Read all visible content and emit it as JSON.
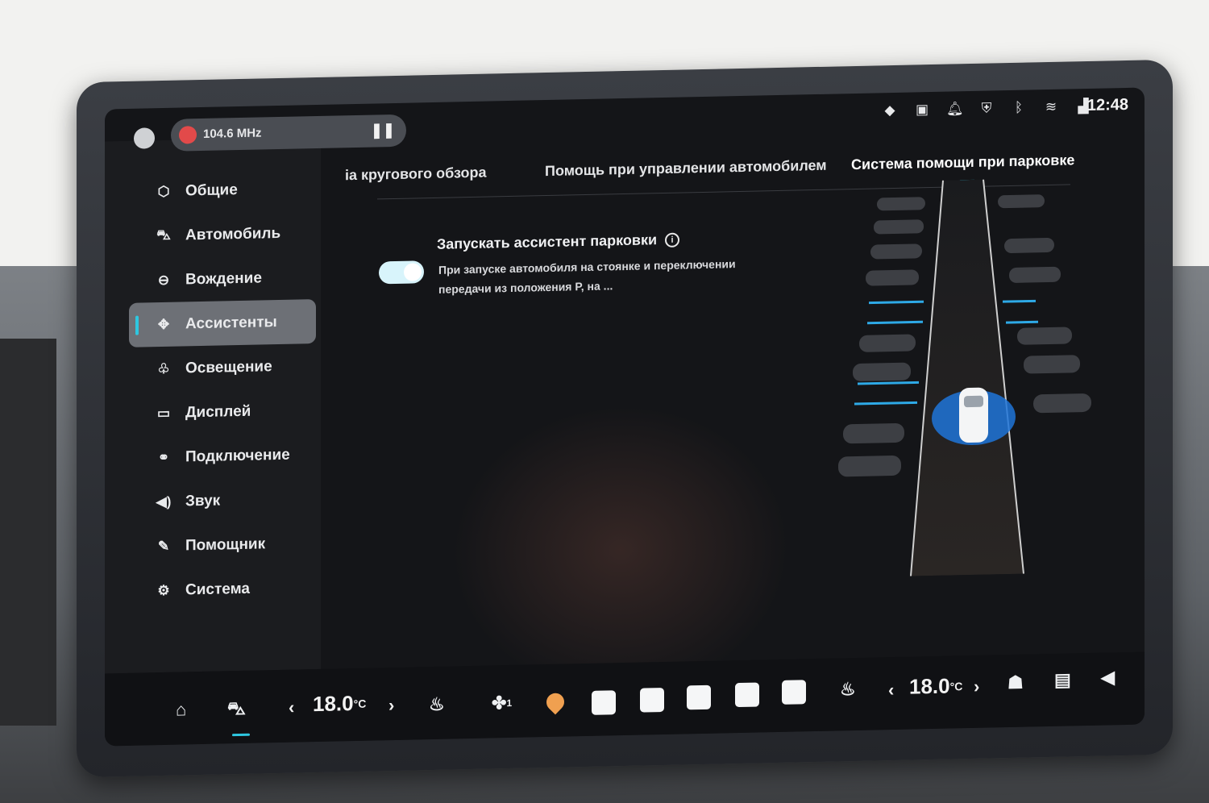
{
  "status_bar": {
    "media_text": "104.6 MHz",
    "pause_glyph": "❚❚",
    "icons": [
      "map-pin-icon",
      "phone-projection-icon",
      "bell-icon",
      "shield-icon",
      "bluetooth-icon",
      "wifi-icon",
      "signal-icon"
    ],
    "time": "12:48"
  },
  "sidebar": {
    "items": [
      {
        "label": "Общие",
        "icon": "general-icon",
        "active": false
      },
      {
        "label": "Автомобиль",
        "icon": "car-icon",
        "active": false
      },
      {
        "label": "Вождение",
        "icon": "steering-wheel-icon",
        "active": false
      },
      {
        "label": "Ассистенты",
        "icon": "assistant-icon",
        "active": true
      },
      {
        "label": "Освещение",
        "icon": "light-icon",
        "active": false
      },
      {
        "label": "Дисплей",
        "icon": "display-icon",
        "active": false
      },
      {
        "label": "Подключение",
        "icon": "link-icon",
        "active": false
      },
      {
        "label": "Звук",
        "icon": "speaker-icon",
        "active": false
      },
      {
        "label": "Помощник",
        "icon": "voice-assistant-icon",
        "active": false
      },
      {
        "label": "Система",
        "icon": "settings-gear-icon",
        "active": false
      }
    ]
  },
  "tabs": [
    {
      "label": "іа кругового обзора",
      "active": false
    },
    {
      "label": "Помощь при управлении автомобилем",
      "active": false
    },
    {
      "label": "Система помощи при парковке",
      "active": true
    }
  ],
  "setting": {
    "title": "Запускать ассистент парковки",
    "description": "При запуске автомобиля на стоянке и переключении передачи из положения Р, на ...",
    "enabled": true
  },
  "bottom_bar": {
    "left_temp": "18.0",
    "right_temp": "18.0",
    "temp_unit": "°C",
    "fan_level": "1"
  },
  "colors": {
    "accent": "#2ec7e0",
    "screen_bg": "#141518",
    "active_item_bg": "#6d7076",
    "toggle_on": "#d8f4fb"
  }
}
